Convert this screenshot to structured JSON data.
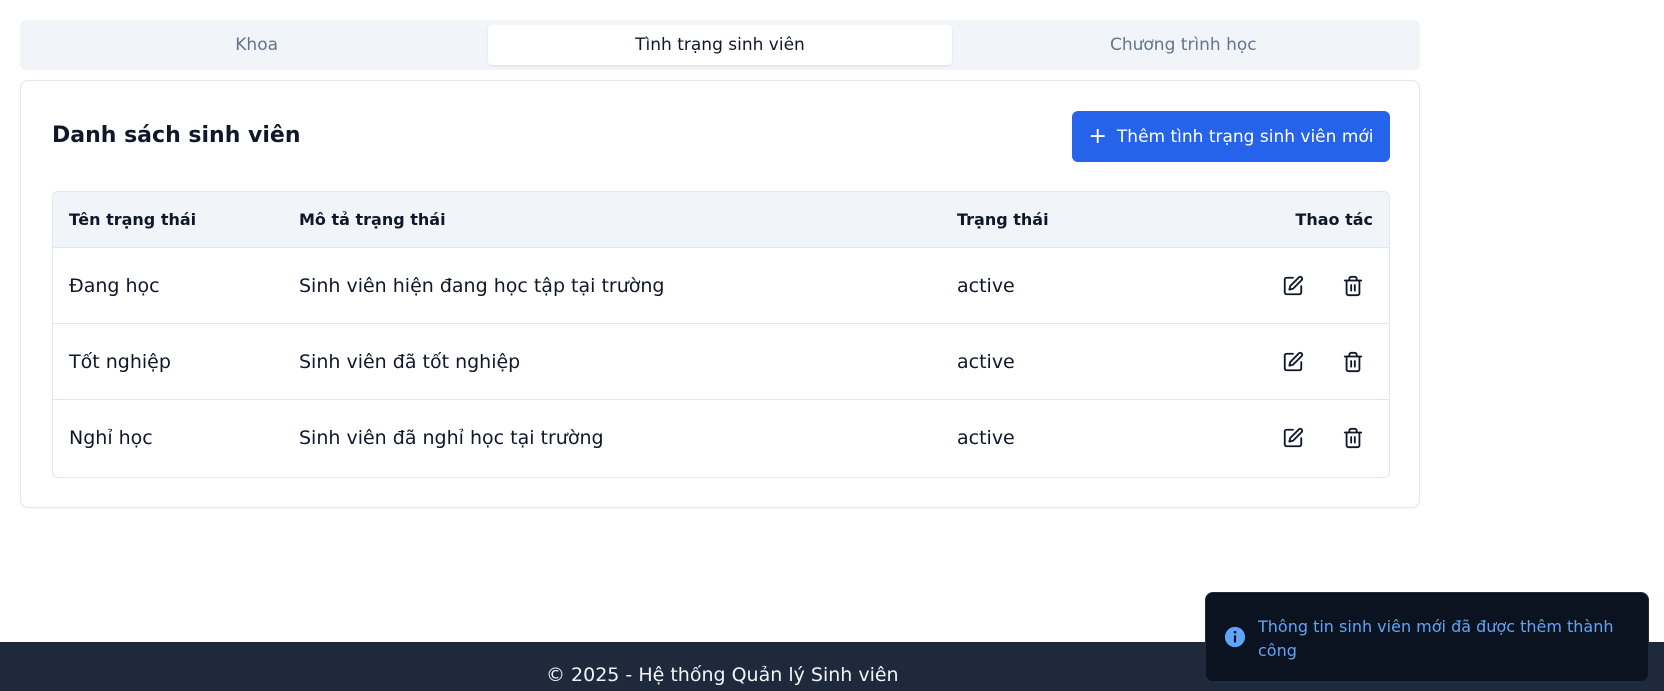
{
  "tabs": [
    {
      "label": "Khoa",
      "active": false
    },
    {
      "label": "Tình trạng sinh viên",
      "active": true
    },
    {
      "label": "Chương trình học",
      "active": false
    }
  ],
  "card": {
    "title": "Danh sách sinh viên",
    "add_button_label": "Thêm tình trạng sinh viên mới",
    "add_button_icon": "plus-icon"
  },
  "table": {
    "headers": [
      "Tên trạng thái",
      "Mô tả trạng thái",
      "Trạng thái",
      "Thao tác"
    ],
    "rows": [
      {
        "name": "Đang học",
        "description": "Sinh viên hiện đang học tập tại trường",
        "status": "active"
      },
      {
        "name": "Tốt nghiệp",
        "description": "Sinh viên đã tốt nghiệp",
        "status": "active"
      },
      {
        "name": "Nghỉ học",
        "description": "Sinh viên đã nghỉ học tại trường",
        "status": "active"
      }
    ],
    "row_actions": [
      "edit-icon",
      "trash-icon"
    ]
  },
  "footer": {
    "text": "© 2025 - Hệ thống Quản lý Sinh viên"
  },
  "toast": {
    "icon": "info-icon",
    "message": "Thông tin sinh viên mới đã được thêm thành công"
  },
  "colors": {
    "primary": "#2563eb",
    "footer_bg": "#1e293b",
    "toast_bg": "#0b1220",
    "toast_text": "#60a5fa"
  }
}
